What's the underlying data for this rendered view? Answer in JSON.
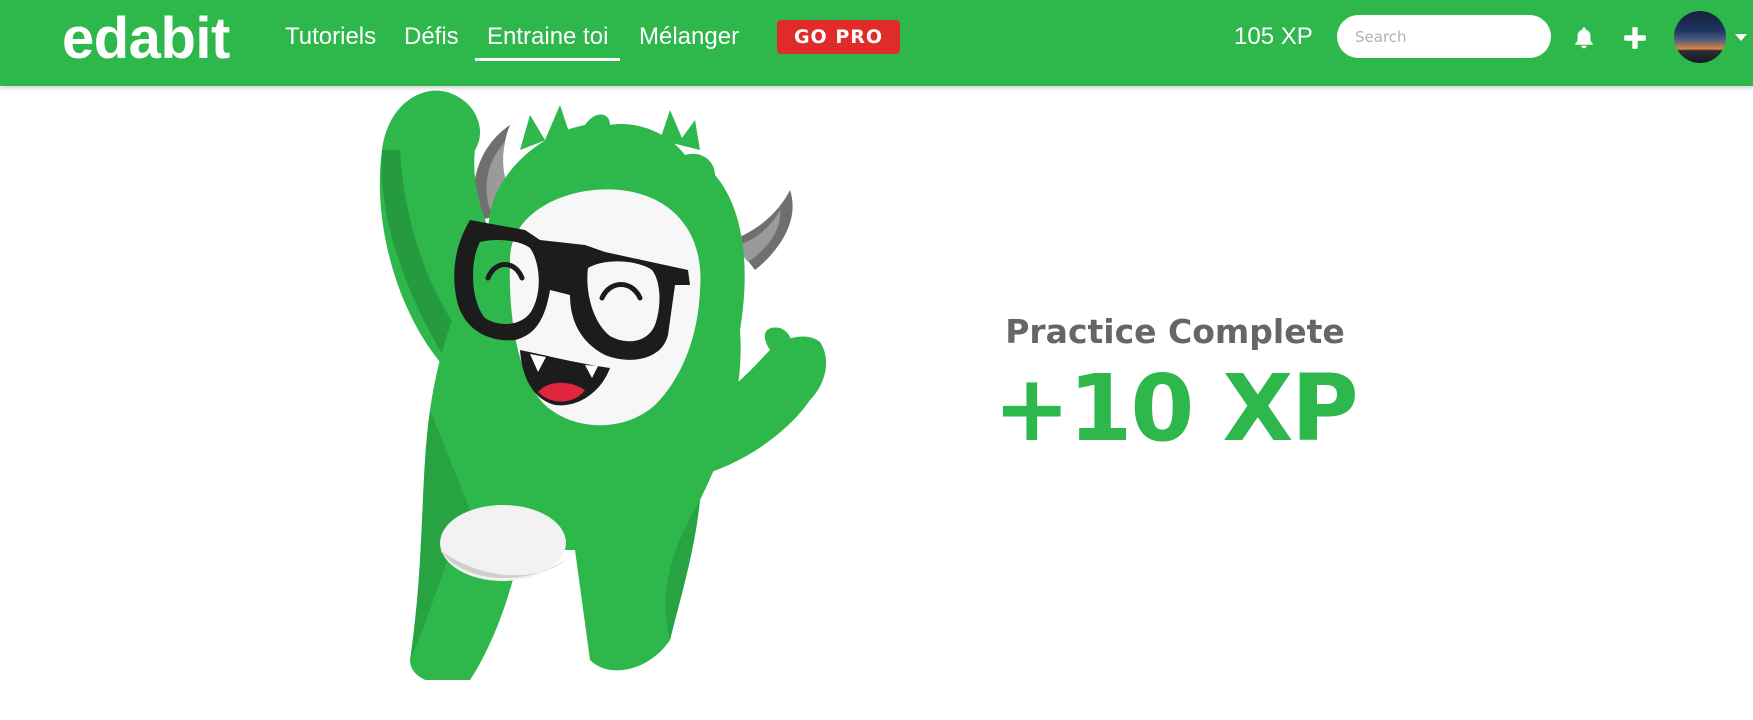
{
  "header": {
    "logo": "edabit",
    "nav": [
      {
        "label": "Tutoriels"
      },
      {
        "label": "Défis"
      },
      {
        "label": "Entraine toi",
        "active": true
      },
      {
        "label": "Mélanger"
      }
    ],
    "go_pro": "GO PRO",
    "xp": "105 XP",
    "search": {
      "placeholder": "Search",
      "value": ""
    },
    "icons": [
      "bell-icon",
      "plus-icon",
      "avatar",
      "chevron-down-icon"
    ]
  },
  "main": {
    "title": "Practice Complete",
    "xp_gain": "+10 XP"
  },
  "colors": {
    "brand_green": "#2eb84c",
    "pro_red": "#e02b2b",
    "title_gray": "#666666"
  }
}
